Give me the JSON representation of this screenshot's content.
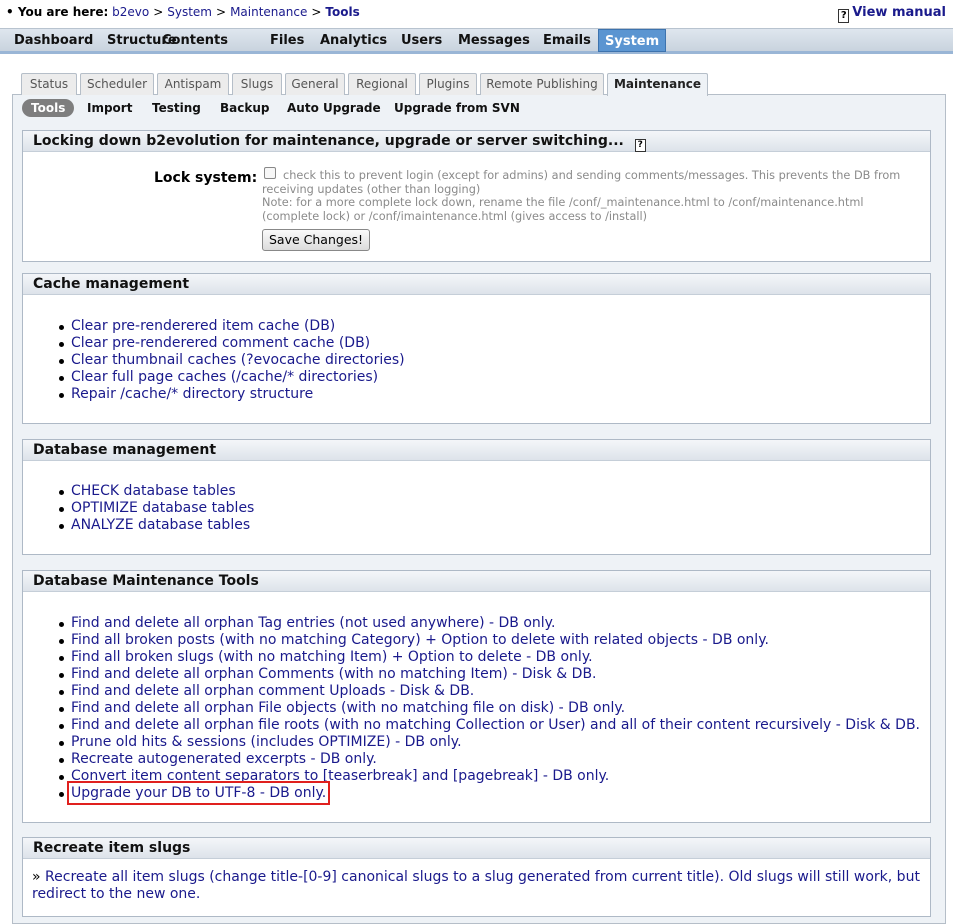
{
  "breadcrumb": {
    "prefix": "You are here:",
    "items": [
      "b2evo",
      "System",
      "Maintenance"
    ],
    "current": "Tools",
    "separator": ">"
  },
  "view_manual": {
    "label": "View manual",
    "icon": "help-icon"
  },
  "main_menu": {
    "items": [
      "Dashboard",
      "Structure",
      "Contents",
      "Files",
      "Analytics",
      "Users",
      "Messages",
      "Emails",
      "System"
    ],
    "selected": "System"
  },
  "tabs": {
    "items": [
      "Status",
      "Scheduler",
      "Antispam",
      "Slugs",
      "General",
      "Regional",
      "Plugins",
      "Remote Publishing",
      "Maintenance"
    ],
    "selected": "Maintenance"
  },
  "subtabs": {
    "items": [
      "Tools",
      "Import",
      "Testing",
      "Backup",
      "Auto Upgrade",
      "Upgrade from SVN"
    ],
    "selected": "Tools"
  },
  "lock_section": {
    "title": "Locking down b2evolution for maintenance, upgrade or server switching...",
    "label": "Lock system:",
    "checked": false,
    "note_1": "check this to prevent login (except for admins) and sending comments/messages. This prevents the DB from receiving updates (other than logging)",
    "note_2": "Note: for a more complete lock down, rename the file /conf/_maintenance.html to /conf/maintenance.html (complete lock) or /conf/imaintenance.html (gives access to /install)",
    "save_label": "Save Changes!"
  },
  "cache_section": {
    "title": "Cache management",
    "items": [
      "Clear pre-renderered item cache (DB)",
      "Clear pre-renderered comment cache (DB)",
      "Clear thumbnail caches (?evocache directories)",
      "Clear full page caches (/cache/* directories)",
      "Repair /cache/* directory structure"
    ]
  },
  "db_section": {
    "title": "Database management",
    "items": [
      "CHECK database tables",
      "OPTIMIZE database tables",
      "ANALYZE database tables"
    ]
  },
  "tools_section": {
    "title": "Database Maintenance Tools",
    "items": [
      "Find and delete all orphan Tag entries (not used anywhere) - DB only.",
      "Find all broken posts (with no matching Category) + Option to delete with related objects - DB only.",
      "Find all broken slugs (with no matching Item) + Option to delete - DB only.",
      "Find and delete all orphan Comments (with no matching Item) - Disk & DB.",
      "Find and delete all orphan comment Uploads - Disk & DB.",
      "Find and delete all orphan File objects (with no matching file on disk) - DB only.",
      "Find and delete all orphan file roots (with no matching Collection or User) and all of their content recursively - Disk & DB.",
      "Prune old hits & sessions (includes OPTIMIZE) - DB only.",
      "Recreate autogenerated excerpts - DB only.",
      "Convert item content separators to [teaserbreak] and [pagebreak] - DB only.",
      "Upgrade your DB to UTF-8 - DB only."
    ],
    "highlighted_index": 10,
    "highlight_color": "#e0201e"
  },
  "slugs_section": {
    "title": "Recreate item slugs",
    "bullet": "»",
    "text": "Recreate all item slugs (change title-[0-9] canonical slugs to a slug generated from current title). Old slugs will still work, but redirect to the new one."
  },
  "colors": {
    "link": "#1a1a8c",
    "menu_selected": "#5b95d1",
    "subtab_selected": "#7e7e7e"
  }
}
